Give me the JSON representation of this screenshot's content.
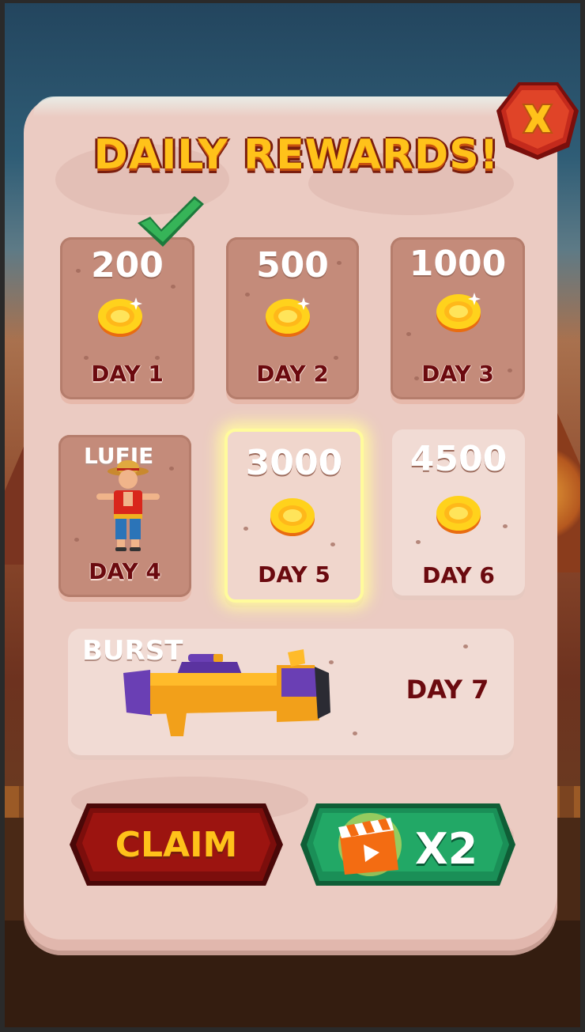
{
  "title": "DAILY REWARDS!",
  "colors": {
    "title_fill": "#ffc21a",
    "day_label": "#6b0a0f",
    "claim_button": "#7c0e0c",
    "x2_button": "#1a8f57",
    "close_button": "#c2221a"
  },
  "rewards": [
    {
      "day": "DAY 1",
      "amount": "200",
      "type": "coins",
      "claimed": true,
      "icon": "coin-icon"
    },
    {
      "day": "DAY 2",
      "amount": "500",
      "type": "coins",
      "icon": "coin-icon"
    },
    {
      "day": "DAY 3",
      "amount": "1000",
      "type": "coins",
      "icon": "coin-icon"
    },
    {
      "day": "DAY 4",
      "name": "LUFIE",
      "type": "character",
      "icon": "character-icon"
    },
    {
      "day": "DAY 5",
      "amount": "3000",
      "type": "coins",
      "selected": true,
      "icon": "coin-icon"
    },
    {
      "day": "DAY 6",
      "amount": "4500",
      "type": "coins",
      "icon": "coin-icon"
    },
    {
      "day": "DAY 7",
      "name": "BURST",
      "type": "weapon",
      "icon": "bazooka-icon"
    }
  ],
  "buttons": {
    "claim": "CLAIM",
    "x2": "X2",
    "x2_icon": "clapperboard-play-icon",
    "close_icon": "close-x-icon"
  }
}
